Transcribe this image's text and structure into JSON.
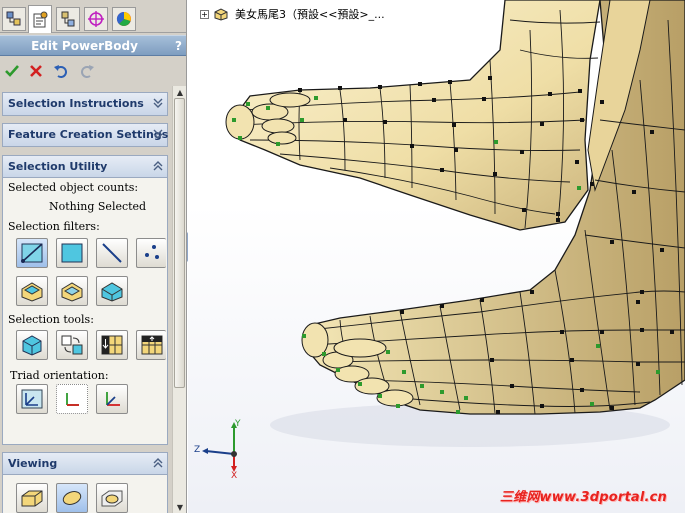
{
  "property_manager": {
    "title": "Edit PowerBody",
    "help_label": "?",
    "tabs": [
      "feature-manager-tab",
      "property-manager-tab",
      "configuration-manager-tab",
      "dim-xpert-tab",
      "appearance-tab"
    ],
    "actions": [
      "ok-check-icon",
      "cancel-x-icon",
      "undo-icon",
      "redo-icon"
    ],
    "groups": {
      "selection_instructions": {
        "title": "Selection Instructions",
        "state": "collapsed"
      },
      "feature_creation_settings": {
        "title": "Feature Creation Settings",
        "state": "collapsed"
      },
      "selection_utility": {
        "title": "Selection Utility",
        "state": "expanded",
        "counts_label": "Selected object counts:",
        "counts_value": "Nothing Selected",
        "filters_label": "Selection filters:",
        "tools_label": "Selection tools:",
        "triad_label": "Triad orientation:"
      },
      "viewing": {
        "title": "Viewing",
        "state": "expanded"
      }
    }
  },
  "tree": {
    "expand_label": "+",
    "item_label": "美女馬尾3（預設<<預設>_..."
  },
  "triad": {
    "x_label": "X",
    "y_label": "Y",
    "z_label": "Z"
  },
  "watermark": "三维网www.3dportal.cn",
  "colors": {
    "title_bar": "#7e9dc0",
    "group_header_text": "#1f3a6b",
    "ok_green": "#2d9a2d",
    "cancel_red": "#d22020",
    "mesh_surface": "#f3e6b8",
    "watermark_red": "#e8231f"
  }
}
